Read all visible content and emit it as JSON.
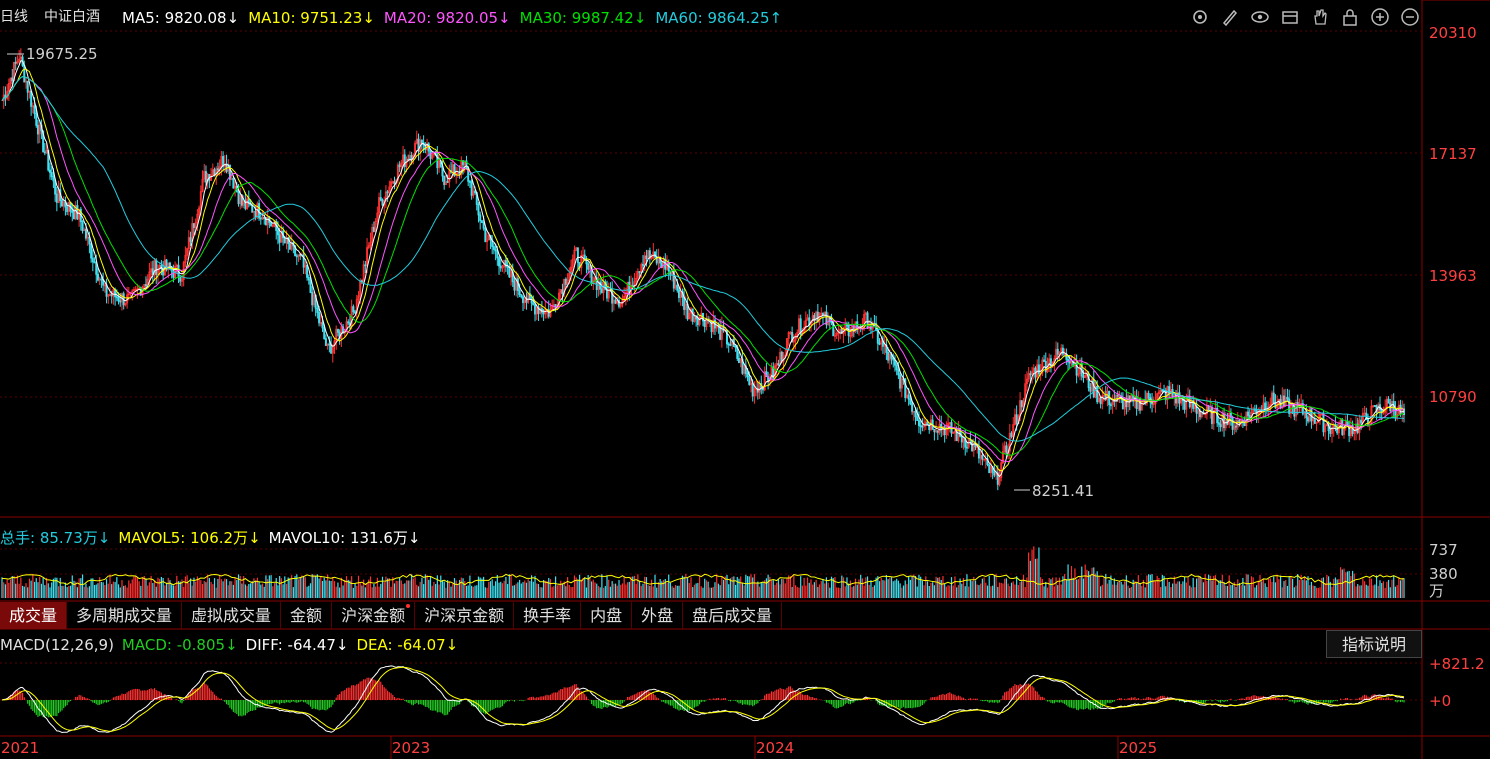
{
  "header": {
    "period": "日线",
    "name": "中证白酒",
    "ma": [
      {
        "label": "MA5: 9820.08",
        "arrow": "↓",
        "color": "#ffffff"
      },
      {
        "label": "MA10: 9751.23",
        "arrow": "↓",
        "color": "#ffff00"
      },
      {
        "label": "MA20: 9820.05",
        "arrow": "↓",
        "color": "#ff55ff"
      },
      {
        "label": "MA30: 9987.42",
        "arrow": "↓",
        "color": "#00e000"
      },
      {
        "label": "MA60: 9864.25",
        "arrow": "↑",
        "color": "#22ccdd"
      }
    ],
    "toolbar_icons": [
      "settings-icon",
      "pen-icon",
      "eye-icon",
      "package-icon",
      "hand-icon",
      "lock-icon",
      "zoom-in-icon",
      "zoom-out-icon"
    ]
  },
  "price_axis": {
    "labels": [
      "20310",
      "17137",
      "13963",
      "10790"
    ]
  },
  "annotations": {
    "high": "19675.25",
    "low": "8251.41"
  },
  "volume_panel": {
    "legend": [
      {
        "label": "总手: 85.73万",
        "arrow": "↓",
        "color": "#22ccdd"
      },
      {
        "label": "MAVOL5: 106.2万",
        "arrow": "↓",
        "color": "#ffff00"
      },
      {
        "label": "MAVOL10: 131.6万",
        "arrow": "↓",
        "color": "#ffffff"
      }
    ],
    "axis": [
      "737",
      "380"
    ],
    "unit": "万"
  },
  "tabs": [
    "成交量",
    "多周期成交量",
    "虚拟成交量",
    "金额",
    "沪深金额",
    "沪深京金额",
    "换手率",
    "内盘",
    "外盘",
    "盘后成交量"
  ],
  "macd_panel": {
    "legend": [
      {
        "label": "MACD(12,26,9)",
        "arrow": "",
        "color": "#e0e0e0"
      },
      {
        "label": "MACD: -0.805",
        "arrow": "↓",
        "color": "#22cc22"
      },
      {
        "label": "DIFF: -64.47",
        "arrow": "↓",
        "color": "#ffffff"
      },
      {
        "label": "DEA: -64.07",
        "arrow": "↓",
        "color": "#ffff00"
      }
    ],
    "axis": [
      "+821.2",
      "+0"
    ],
    "help_label": "指标说明"
  },
  "x_axis": {
    "labels": [
      "2021",
      "2023",
      "2024",
      "2025"
    ]
  },
  "chart_data": {
    "type": "line",
    "title": "中证白酒",
    "price_anchors": {
      "x_index": [
        0,
        10,
        20,
        32,
        45,
        60,
        75,
        90,
        105,
        118,
        130,
        140,
        152,
        165,
        175,
        190,
        205,
        220,
        232,
        245,
        258,
        270,
        282,
        295,
        308,
        320,
        335,
        350,
        362,
        375,
        388,
        400,
        412,
        425,
        438,
        450,
        460,
        475,
        490,
        505,
        520,
        535,
        550,
        565,
        580,
        600,
        620,
        640,
        660,
        680,
        700,
        720,
        740,
        760,
        775,
        790,
        800,
        810,
        818
      ],
      "close": [
        18500,
        19675,
        18000,
        16000,
        15500,
        13500,
        13300,
        14200,
        14000,
        16500,
        17000,
        15800,
        15600,
        14800,
        14300,
        12000,
        13000,
        15800,
        16800,
        17500,
        16500,
        16800,
        15000,
        14000,
        13200,
        13000,
        14500,
        13600,
        13300,
        14500,
        14200,
        13000,
        12800,
        12200,
        11000,
        11400,
        12400,
        13000,
        12400,
        12800,
        11600,
        10200,
        10000,
        9600,
        8600,
        11400,
        12000,
        10800,
        10600,
        10900,
        10400,
        10100,
        10700,
        10400,
        10000,
        10000,
        10400,
        10600,
        10300
      ]
    },
    "ma_series": [
      "MA5",
      "MA10",
      "MA20",
      "MA30",
      "MA60"
    ],
    "volume_unit": "万",
    "macd_params": "12,26,9"
  }
}
